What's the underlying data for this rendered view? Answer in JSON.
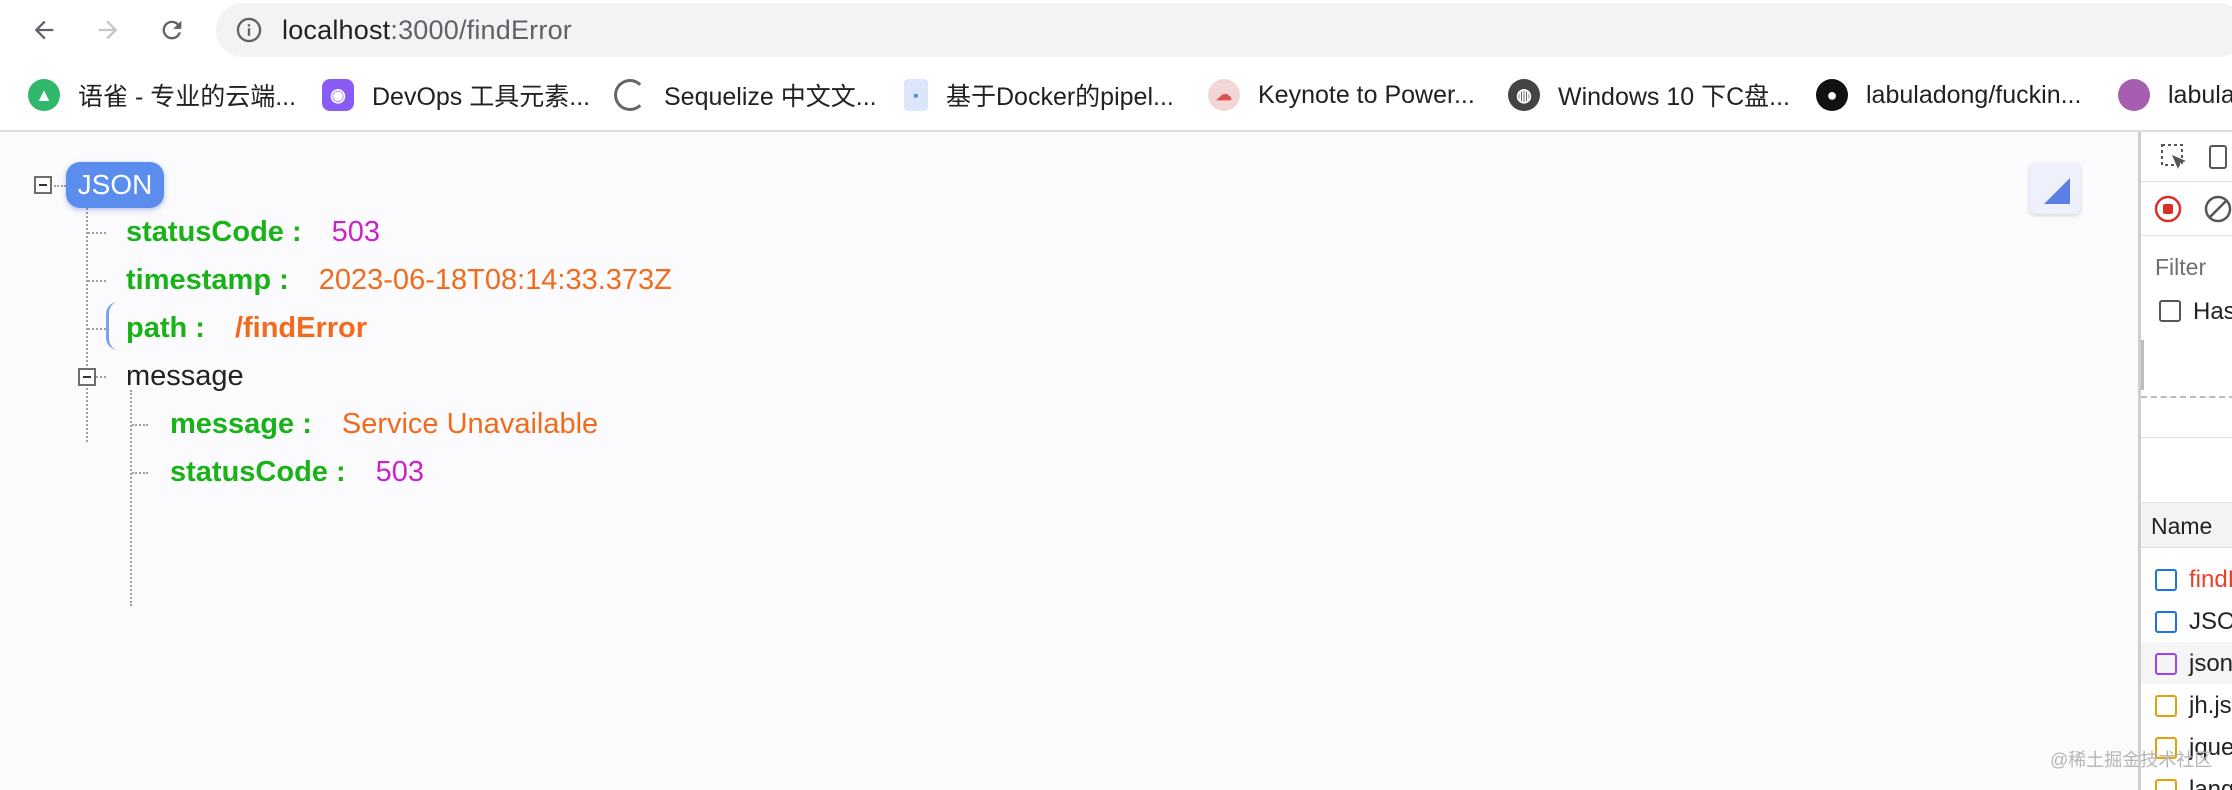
{
  "browser": {
    "url_host": "localhost",
    "url_path": ":3000/findError",
    "bookmarks": [
      {
        "label": "语雀 - 专业的云端...",
        "icon": "yuque-icon",
        "color": "#2fb86a"
      },
      {
        "label": "DevOps 工具元素...",
        "icon": "devops-icon",
        "color": "#8a5cf5"
      },
      {
        "label": "Sequelize 中文文...",
        "icon": "sequelize-icon",
        "color": "#555555"
      },
      {
        "label": "基于Docker的pipel...",
        "icon": "document-icon",
        "color": "#4d7bd6"
      },
      {
        "label": "Keynote to Power...",
        "icon": "cloud-icon",
        "color": "#d9534f"
      },
      {
        "label": "Windows 10 下C盘...",
        "icon": "globe-icon",
        "color": "#444444"
      },
      {
        "label": "labuladong/fuckin...",
        "icon": "github-icon",
        "color": "#111111"
      },
      {
        "label": "labula",
        "icon": "avatar-icon",
        "color": "#a65fb0"
      }
    ]
  },
  "json_view": {
    "root_label": "JSON",
    "rows": [
      {
        "key": "statusCode :",
        "value": "503"
      },
      {
        "key": "timestamp :",
        "value": "2023-06-18T08:14:33.373Z"
      },
      {
        "key": "path :",
        "value": "/findError"
      }
    ],
    "message_group": {
      "label": "message",
      "rows": [
        {
          "key": "message :",
          "value": "Service Unavailable"
        },
        {
          "key": "statusCode :",
          "value": "503"
        }
      ]
    }
  },
  "devtools": {
    "filter_placeholder": "Filter",
    "checkbox_label": "Has",
    "name_header": "Name",
    "requests": [
      {
        "label": "findE",
        "type": "document",
        "color": "#e8402a",
        "icon_color": "#1a73e8"
      },
      {
        "label": "JSO",
        "type": "document",
        "color": "#222222",
        "icon_color": "#1a73e8"
      },
      {
        "label": "json",
        "type": "stylesheet",
        "color": "#222222",
        "icon_color": "#a142f4"
      },
      {
        "label": "jh.js",
        "type": "script",
        "color": "#222222",
        "icon_color": "#e3a008"
      },
      {
        "label": "jque",
        "type": "script",
        "color": "#222222",
        "icon_color": "#e3a008"
      },
      {
        "label": "lang",
        "type": "script",
        "color": "#222222",
        "icon_color": "#e3a008"
      }
    ]
  },
  "watermark": "@稀土掘金技术社区"
}
